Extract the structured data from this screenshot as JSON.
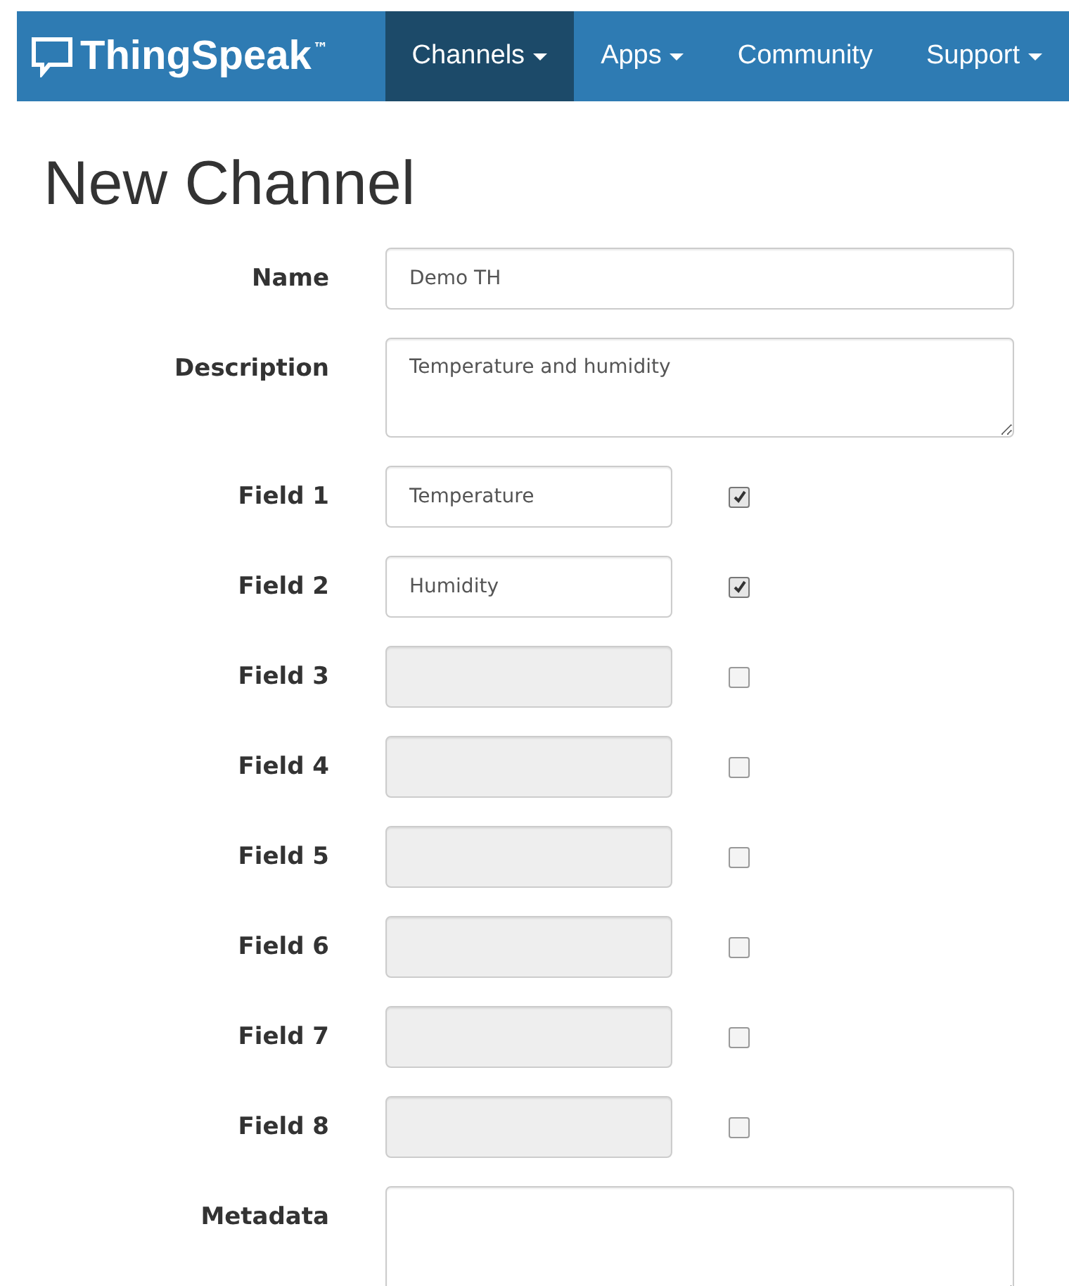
{
  "brand": {
    "name": "ThingSpeak",
    "mark": "™"
  },
  "nav": [
    {
      "label": "Channels",
      "dropdown": true,
      "selected": true
    },
    {
      "label": "Apps",
      "dropdown": true,
      "selected": false
    },
    {
      "label": "Community",
      "dropdown": false,
      "selected": false
    },
    {
      "label": "Support",
      "dropdown": true,
      "selected": false
    }
  ],
  "heading": "New Channel",
  "name": {
    "label": "Name",
    "value": "Demo TH"
  },
  "description": {
    "label": "Description",
    "value": "Temperature and humidity"
  },
  "fields": [
    {
      "label": "Field 1",
      "value": "Temperature",
      "checked": true,
      "disabled": false
    },
    {
      "label": "Field 2",
      "value": "Humidity",
      "checked": true,
      "disabled": false
    },
    {
      "label": "Field 3",
      "checked": false,
      "disabled": true
    },
    {
      "label": "Field 4",
      "checked": false,
      "disabled": true
    },
    {
      "label": "Field 5",
      "checked": false,
      "disabled": true
    },
    {
      "label": "Field 6",
      "checked": false,
      "disabled": true
    },
    {
      "label": "Field 7",
      "checked": false,
      "disabled": true
    },
    {
      "label": "Field 8",
      "checked": false,
      "disabled": true
    }
  ],
  "metadata": {
    "label": "Metadata"
  }
}
